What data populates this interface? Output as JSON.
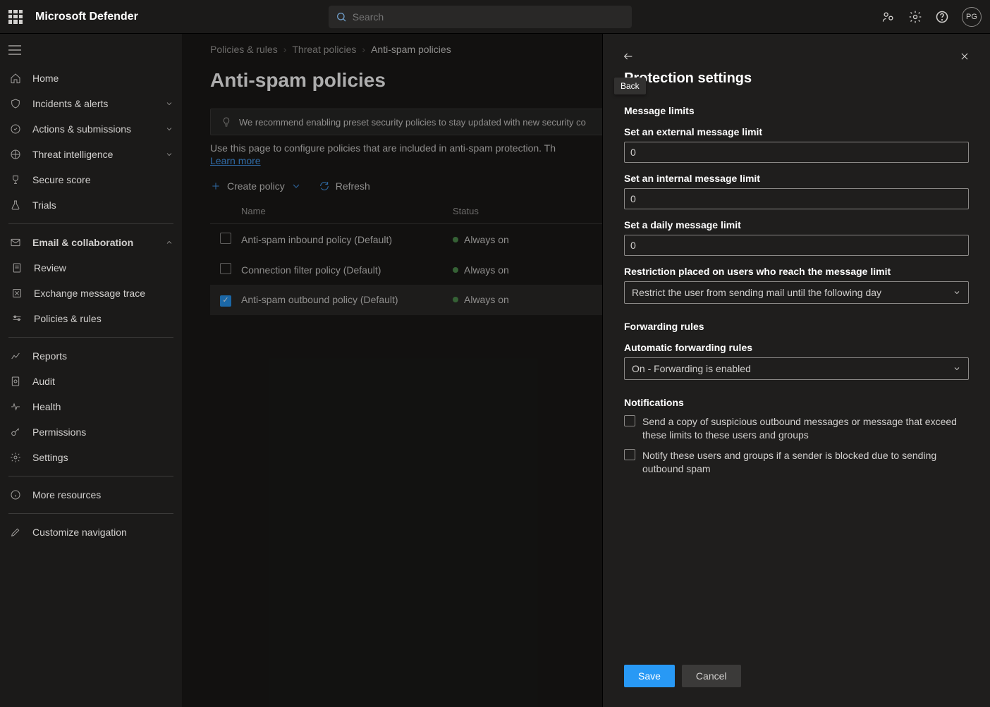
{
  "app_title": "Microsoft Defender",
  "search_placeholder": "Search",
  "avatar_initials": "PG",
  "sidebar": {
    "items": [
      {
        "label": "Home"
      },
      {
        "label": "Incidents & alerts"
      },
      {
        "label": "Actions & submissions"
      },
      {
        "label": "Threat intelligence"
      },
      {
        "label": "Secure score"
      },
      {
        "label": "Trials"
      }
    ],
    "email_header": "Email & collaboration",
    "email_items": [
      {
        "label": "Review"
      },
      {
        "label": "Exchange message trace"
      },
      {
        "label": "Policies & rules"
      }
    ],
    "bottom_items": [
      {
        "label": "Reports"
      },
      {
        "label": "Audit"
      },
      {
        "label": "Health"
      },
      {
        "label": "Permissions"
      },
      {
        "label": "Settings"
      }
    ],
    "more": "More resources",
    "customize": "Customize navigation"
  },
  "breadcrumbs": {
    "a": "Policies & rules",
    "b": "Threat policies",
    "c": "Anti-spam policies"
  },
  "page_title": "Anti-spam policies",
  "info_strip": "We recommend enabling preset security policies to stay updated with new security co",
  "blurb": "Use this page to configure policies that are included in anti-spam protection. Th",
  "learn_more": "Learn more",
  "toolbar": {
    "create": "Create policy",
    "refresh": "Refresh"
  },
  "table": {
    "head": {
      "name": "Name",
      "status": "Status"
    },
    "rows": [
      {
        "name": "Anti-spam inbound policy (Default)",
        "status": "Always on",
        "checked": false
      },
      {
        "name": "Connection filter policy (Default)",
        "status": "Always on",
        "checked": false
      },
      {
        "name": "Anti-spam outbound policy (Default)",
        "status": "Always on",
        "checked": true
      }
    ]
  },
  "panel": {
    "back_tooltip": "Back",
    "title": "Protection settings",
    "message_limits_h": "Message limits",
    "ext_label": "Set an external message limit",
    "ext_value": "0",
    "int_label": "Set an internal message limit",
    "int_value": "0",
    "daily_label": "Set a daily message limit",
    "daily_value": "0",
    "restrict_label": "Restriction placed on users who reach the message limit",
    "restrict_value": "Restrict the user from sending mail until the following day",
    "fwd_h": "Forwarding rules",
    "fwd_label": "Automatic forwarding rules",
    "fwd_value": "On - Forwarding is enabled",
    "notif_h": "Notifications",
    "notif_copy": "Send a copy of suspicious outbound messages or message that exceed these limits to these users and groups",
    "notif_block": "Notify these users and groups if a sender is blocked due to sending outbound spam",
    "save": "Save",
    "cancel": "Cancel"
  }
}
